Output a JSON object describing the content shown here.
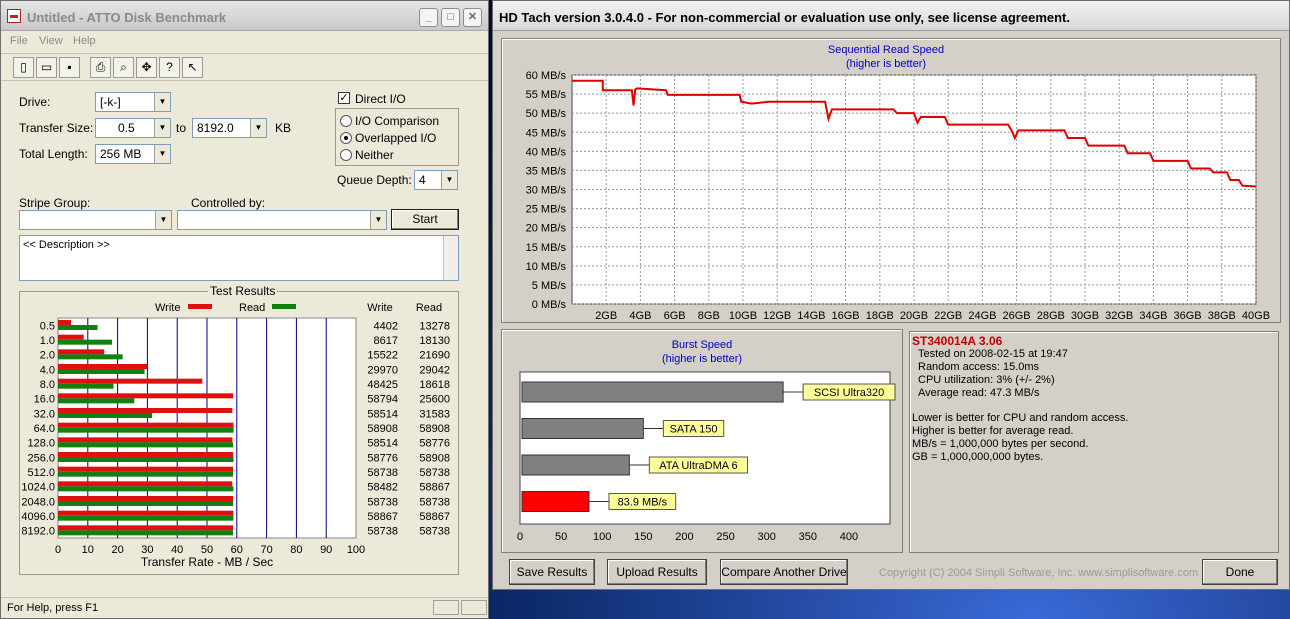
{
  "atto": {
    "title": "Untitled - ATTO Disk Benchmark",
    "menu": [
      "File",
      "View",
      "Help"
    ],
    "toolbar_icons": [
      "new-file-icon",
      "open-folder-icon",
      "save-icon",
      "print-icon",
      "print-preview-icon",
      "move-icon",
      "help-icon",
      "context-help-icon"
    ],
    "drive_label": "Drive:",
    "drive_value": "[-k-]",
    "transfer_size_label": "Transfer Size:",
    "transfer_from": "0.5",
    "to_label": "to",
    "transfer_to": "8192.0",
    "kb_label": "KB",
    "total_length_label": "Total Length:",
    "total_length_value": "256 MB",
    "direct_io_label": "Direct I/O",
    "direct_io_checked": true,
    "radio_options": [
      "I/O Comparison",
      "Overlapped I/O",
      "Neither"
    ],
    "radio_selected": "Overlapped I/O",
    "queue_depth_label": "Queue Depth:",
    "queue_depth_value": "4",
    "stripe_group_label": "Stripe Group:",
    "controlled_by_label": "Controlled by:",
    "start_label": "Start",
    "description": "<< Description >>",
    "results_title": "Test Results",
    "legend_write": "Write",
    "legend_read": "Read",
    "col_write": "Write",
    "col_read": "Read",
    "xlabel": "Transfer Rate - MB / Sec",
    "status": "For Help, press F1",
    "colors": {
      "write": "#e01010",
      "read": "#108010"
    }
  },
  "chart_data": [
    {
      "type": "bar",
      "orientation": "horizontal",
      "title": "Test Results",
      "categories": [
        "0.5",
        "1.0",
        "2.0",
        "4.0",
        "8.0",
        "16.0",
        "32.0",
        "64.0",
        "128.0",
        "256.0",
        "512.0",
        "1024.0",
        "2048.0",
        "4096.0",
        "8192.0"
      ],
      "series": [
        {
          "name": "Write",
          "values": [
            4402,
            8617,
            15522,
            29970,
            48425,
            58794,
            58514,
            58908,
            58514,
            58776,
            58738,
            58482,
            58738,
            58867,
            58738
          ]
        },
        {
          "name": "Read",
          "values": [
            13278,
            18130,
            21690,
            29042,
            18618,
            25600,
            31583,
            58908,
            58776,
            58908,
            58738,
            58867,
            58738,
            58867,
            58738
          ]
        }
      ],
      "xticks": [
        "0",
        "10",
        "20",
        "30",
        "40",
        "50",
        "60",
        "70",
        "80",
        "90",
        "100"
      ],
      "xlim": [
        0,
        100
      ],
      "xlabel": "Transfer Rate - MB / Sec",
      "legend": "top"
    },
    {
      "type": "line",
      "title": "Sequential Read Speed",
      "subtitle": "(higher is better)",
      "xlim": [
        0,
        40
      ],
      "ylim": [
        0,
        60
      ],
      "xticks": [
        "2GB",
        "4GB",
        "6GB",
        "8GB",
        "10GB",
        "12GB",
        "14GB",
        "16GB",
        "18GB",
        "20GB",
        "22GB",
        "24GB",
        "26GB",
        "28GB",
        "30GB",
        "32GB",
        "34GB",
        "36GB",
        "38GB",
        "40GB"
      ],
      "yticks": [
        "0 MB/s",
        "5 MB/s",
        "10 MB/s",
        "15 MB/s",
        "20 MB/s",
        "25 MB/s",
        "30 MB/s",
        "35 MB/s",
        "40 MB/s",
        "45 MB/s",
        "50 MB/s",
        "55 MB/s",
        "60 MB/s"
      ],
      "grid": true,
      "x": [
        0,
        1.8,
        1.8,
        3.5,
        3.6,
        3.7,
        3.8,
        5.5,
        5.6,
        9.8,
        9.9,
        10.5,
        11.5,
        14.8,
        15.0,
        15.2,
        18.8,
        19.0,
        20.0,
        20.2,
        20.4,
        21.8,
        22.0,
        25.5,
        25.7,
        25.9,
        26.1,
        28.8,
        29.0,
        30.0,
        30.2,
        32.3,
        32.5,
        33.8,
        34.0,
        36.0,
        36.2,
        37.3,
        37.5,
        38.3,
        38.5,
        39.0,
        39.2,
        40.0
      ],
      "y": [
        58.5,
        58.5,
        56,
        56,
        52,
        56.2,
        56.5,
        56,
        54.8,
        54.8,
        53,
        52.5,
        53,
        53,
        48.5,
        51,
        51,
        50,
        50,
        47.5,
        49,
        49,
        47,
        47,
        45.5,
        43.5,
        45.5,
        45.5,
        43.5,
        43.5,
        41.5,
        41.5,
        39.5,
        39.5,
        37.5,
        37.5,
        35.5,
        35.5,
        34.5,
        34.5,
        32.5,
        32.5,
        31,
        30.8
      ],
      "color": "#e00000"
    },
    {
      "type": "bar",
      "orientation": "horizontal",
      "title": "Burst Speed",
      "subtitle": "(higher is better)",
      "categories": [
        "SCSI Ultra320",
        "SATA 150",
        "ATA UltraDMA 6",
        "83.9 MB/s"
      ],
      "values": [
        320,
        150,
        133,
        83.9
      ],
      "xlim": [
        0,
        450
      ],
      "xticks": [
        "0",
        "50",
        "100",
        "150",
        "200",
        "250",
        "300",
        "350",
        "400"
      ],
      "colors": {
        "reference": "#808080",
        "measured": "#ff0000",
        "label_bg": "#ffff99"
      }
    }
  ],
  "hdtach": {
    "title": "HD Tach version 3.0.4.0  - For non-commercial or evaluation use only, see license agreement.",
    "drive_name": "ST340014A 3.06",
    "info_lines": [
      "Tested on 2008-02-15 at 19:47",
      "Random access: 15.0ms",
      "CPU utilization: 3% (+/- 2%)",
      "Average read: 47.3 MB/s"
    ],
    "notes": [
      "Lower is better for CPU and random access.",
      "Higher is better for average read.",
      "MB/s = 1,000,000 bytes per second.",
      "GB = 1,000,000,000 bytes."
    ],
    "buttons": {
      "save": "Save Results",
      "upload": "Upload Results",
      "compare": "Compare Another Drive",
      "done": "Done"
    },
    "copyright": "Copyright (C) 2004 Simpli Software, Inc. www.simplisoftware.com"
  }
}
